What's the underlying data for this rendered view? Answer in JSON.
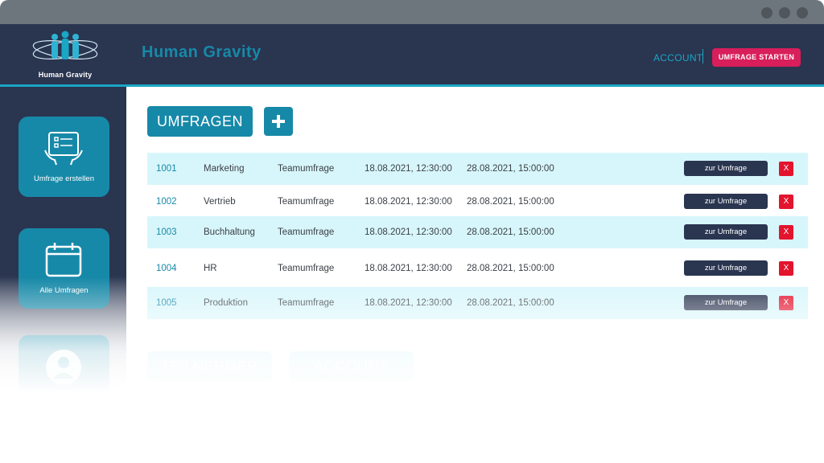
{
  "header": {
    "logo_text": "Human Gravity",
    "brand": "Human Gravity",
    "account_link": "ACCOUNT",
    "start_button": "UMFRAGE STARTEN"
  },
  "sidebar": {
    "items": [
      {
        "label": "Umfrage erstellen",
        "icon": "tablet-checklist-icon"
      },
      {
        "label": "Alle Umfragen",
        "icon": "calendar-icon"
      },
      {
        "label": "",
        "icon": "user-icon"
      }
    ]
  },
  "main": {
    "title_button": "UMFRAGEN",
    "add_icon": "plus-icon",
    "rows": [
      {
        "id": "1001",
        "dept": "Marketing",
        "type": "Teamumfrage",
        "start": "18.08.2021, 12:30:00",
        "end": "28.08.2021, 15:00:00",
        "action": "zur Umfrage",
        "delete": "X"
      },
      {
        "id": "1002",
        "dept": "Vertrieb",
        "type": "Teamumfrage",
        "start": "18.08.2021, 12:30:00",
        "end": "28.08.2021, 15:00:00",
        "action": "zur Umfrage",
        "delete": "X"
      },
      {
        "id": "1003",
        "dept": "Buchhaltung",
        "type": "Teamumfrage",
        "start": "18.08.2021, 12:30:00",
        "end": "28.08.2021, 15:00:00",
        "action": "zur Umfrage",
        "delete": "X"
      },
      {
        "id": "1004",
        "dept": "HR",
        "type": "Teamumfrage",
        "start": "18.08.2021, 12:30:00",
        "end": "28.08.2021, 15:00:00",
        "action": "zur Umfrage",
        "delete": "X"
      },
      {
        "id": "1005",
        "dept": "Produktion",
        "type": "Teamumfrage",
        "start": "18.08.2021, 12:30:00",
        "end": "28.08.2021, 15:00:00",
        "action": "zur Umfrage",
        "delete": "X"
      }
    ],
    "bottom_tabs": [
      "TEILNEHMER",
      "ACCOUNT"
    ]
  },
  "colors": {
    "header_bg": "#2a3550",
    "accent_teal": "#1789a8",
    "accent_pink": "#d81e5b",
    "row_shade": "#d7f6fb",
    "delete_red": "#e3142d"
  }
}
